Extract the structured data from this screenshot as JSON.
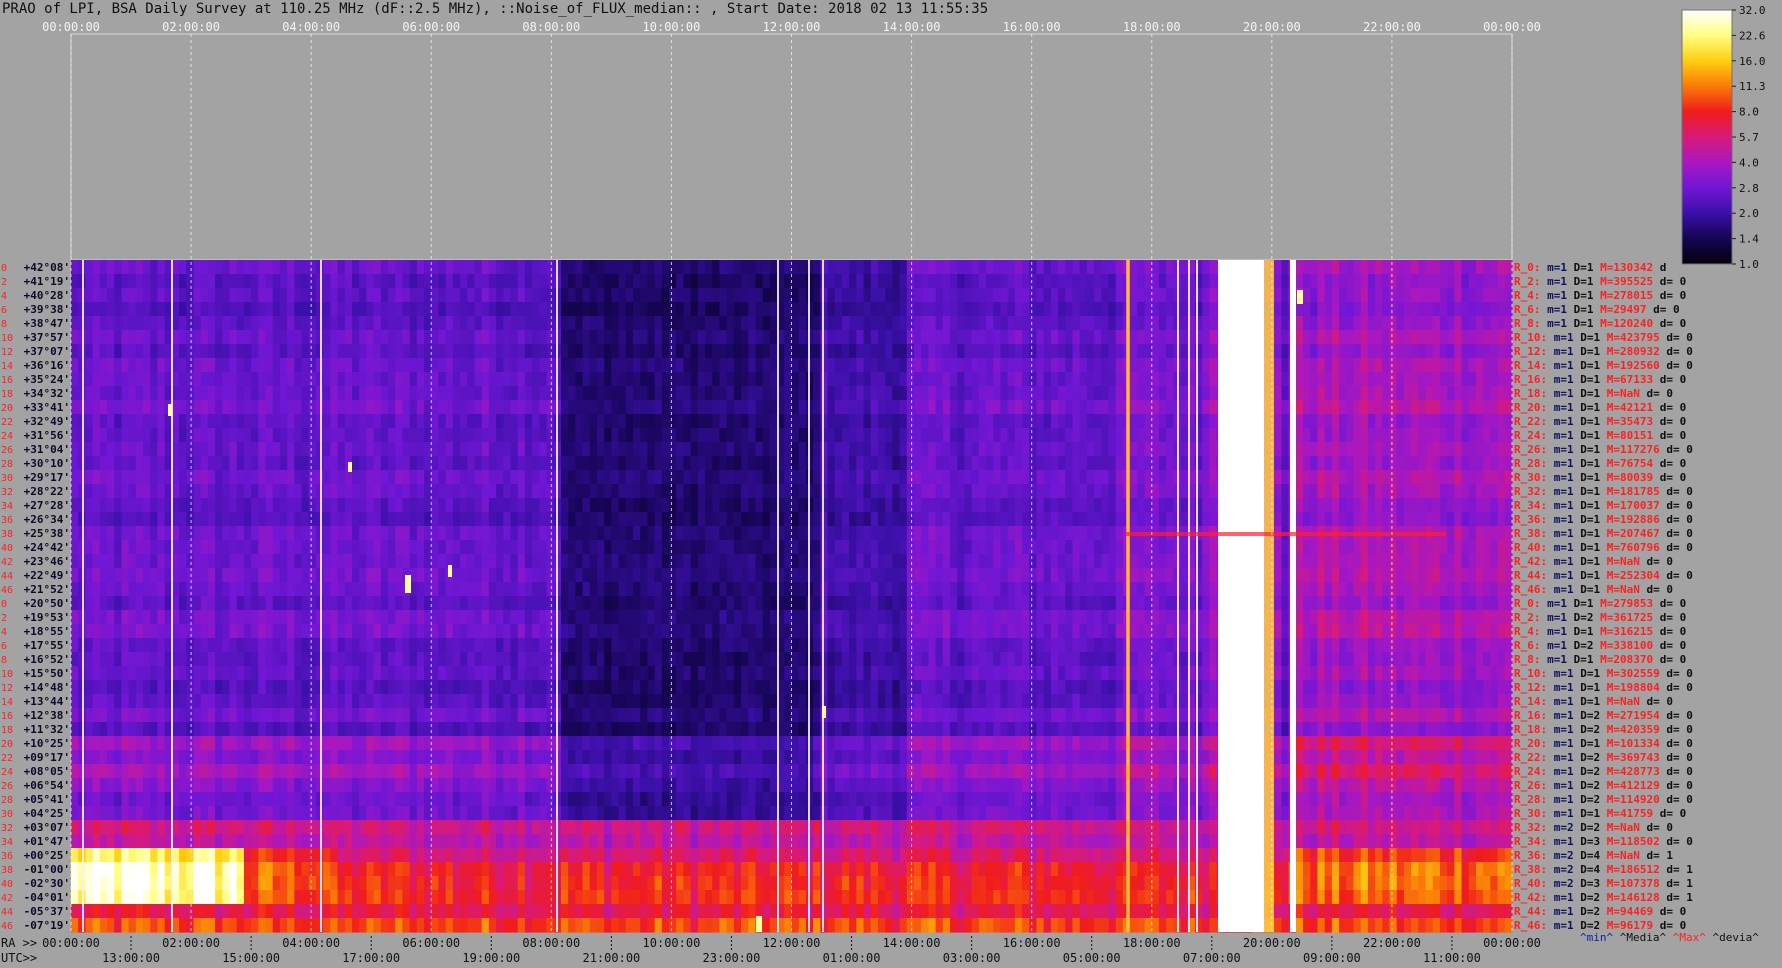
{
  "title": "PRAO of LPI, BSA Daily Survey at 110.25 MHz (dF::2.5 MHz), ::Noise_of_FLUX_median:: , Start Date: 2018 02 13 11:55:35",
  "chart_data": {
    "type": "heatmap",
    "top_axis_ticks": [
      "00:00:00",
      "02:00:00",
      "04:00:00",
      "06:00:00",
      "08:00:00",
      "10:00:00",
      "12:00:00",
      "14:00:00",
      "16:00:00",
      "18:00:00",
      "20:00:00",
      "22:00:00",
      "00:00:00"
    ],
    "bottom_ra_prefix": "RA >>",
    "bottom_ra_ticks": [
      "00:00:00",
      "02:00:00",
      "04:00:00",
      "06:00:00",
      "08:00:00",
      "10:00:00",
      "12:00:00",
      "14:00:00",
      "16:00:00",
      "18:00:00",
      "20:00:00",
      "22:00:00",
      "00:00:00"
    ],
    "bottom_utc_prefix": "UTC>>",
    "bottom_utc_ticks": [
      "13:00:00",
      "15:00:00",
      "17:00:00",
      "19:00:00",
      "21:00:00",
      "23:00:00",
      "01:00:00",
      "03:00:00",
      "05:00:00",
      "07:00:00",
      "09:00:00",
      "11:00:00"
    ],
    "declinations": [
      "+42°08'",
      "+41°19'",
      "+40°28'",
      "+39°38'",
      "+38°47'",
      "+37°57'",
      "+37°07'",
      "+36°16'",
      "+35°24'",
      "+34°32'",
      "+33°41'",
      "+32°49'",
      "+31°56'",
      "+31°04'",
      "+30°10'",
      "+29°17'",
      "+28°22'",
      "+27°28'",
      "+26°34'",
      "+25°38'",
      "+24°42'",
      "+23°46'",
      "+22°49'",
      "+21°52'",
      "+20°50'",
      "+19°53'",
      "+18°55'",
      "+17°55'",
      "+16°52'",
      "+15°50'",
      "+14°48'",
      "+13°44'",
      "+12°38'",
      "+11°32'",
      "+10°25'",
      "+09°17'",
      "+08°05'",
      "+06°54'",
      "+05°41'",
      "+04°25'",
      "+03°07'",
      "+01°47'",
      "+00°25'",
      "-01°00'",
      "-02°30'",
      "-04°01'",
      "-05°37'",
      "-07°19'"
    ],
    "row_numbers": [
      "0",
      "2",
      "4",
      "6",
      "8",
      "10",
      "12",
      "14",
      "16",
      "18",
      "20",
      "22",
      "24",
      "26",
      "28",
      "30",
      "32",
      "34",
      "36",
      "38",
      "40",
      "42",
      "44",
      "46",
      "0",
      "2",
      "4",
      "6",
      "8",
      "10",
      "12",
      "14",
      "16",
      "18",
      "20",
      "22",
      "24",
      "26",
      "28",
      "30",
      "32",
      "34",
      "36",
      "38",
      "40",
      "42",
      "44",
      "46"
    ],
    "stats_rows": [
      {
        "r": "R_0:",
        "m": "m=1",
        "D": "D=1",
        "M": "M=130342",
        "d": "d"
      },
      {
        "r": "R_2:",
        "m": "m=1",
        "D": "D=1",
        "M": "M=395525",
        "d": "d= 0"
      },
      {
        "r": "R_4:",
        "m": "m=1",
        "D": "D=1",
        "M": "M=278015",
        "d": "d= 0"
      },
      {
        "r": "R_6:",
        "m": "m=1",
        "D": "D=1",
        "M": "M=29497",
        "d": "d= 0"
      },
      {
        "r": "R_8:",
        "m": "m=1",
        "D": "D=1",
        "M": "M=120240",
        "d": "d= 0"
      },
      {
        "r": "R_10:",
        "m": "m=1",
        "D": "D=1",
        "M": "M=423795",
        "d": "d= 0"
      },
      {
        "r": "R_12:",
        "m": "m=1",
        "D": "D=1",
        "M": "M=280932",
        "d": "d= 0"
      },
      {
        "r": "R_14:",
        "m": "m=1",
        "D": "D=1",
        "M": "M=192560",
        "d": "d= 0"
      },
      {
        "r": "R_16:",
        "m": "m=1",
        "D": "D=1",
        "M": "M=67133",
        "d": "d= 0"
      },
      {
        "r": "R_18:",
        "m": "m=1",
        "D": "D=1",
        "M": "M=NaN",
        "d": "d= 0"
      },
      {
        "r": "R_20:",
        "m": "m=1",
        "D": "D=1",
        "M": "M=42121",
        "d": "d= 0"
      },
      {
        "r": "R_22:",
        "m": "m=1",
        "D": "D=1",
        "M": "M=35473",
        "d": "d= 0"
      },
      {
        "r": "R_24:",
        "m": "m=1",
        "D": "D=1",
        "M": "M=80151",
        "d": "d= 0"
      },
      {
        "r": "R_26:",
        "m": "m=1",
        "D": "D=1",
        "M": "M=117276",
        "d": "d= 0"
      },
      {
        "r": "R_28:",
        "m": "m=1",
        "D": "D=1",
        "M": "M=76754",
        "d": "d= 0"
      },
      {
        "r": "R_30:",
        "m": "m=1",
        "D": "D=1",
        "M": "M=80039",
        "d": "d= 0"
      },
      {
        "r": "R_32:",
        "m": "m=1",
        "D": "D=1",
        "M": "M=181785",
        "d": "d= 0"
      },
      {
        "r": "R_34:",
        "m": "m=1",
        "D": "D=1",
        "M": "M=170037",
        "d": "d= 0"
      },
      {
        "r": "R_36:",
        "m": "m=1",
        "D": "D=1",
        "M": "M=192886",
        "d": "d= 0"
      },
      {
        "r": "R_38:",
        "m": "m=1",
        "D": "D=1",
        "M": "M=207467",
        "d": "d= 0"
      },
      {
        "r": "R_40:",
        "m": "m=1",
        "D": "D=1",
        "M": "M=760796",
        "d": "d= 0"
      },
      {
        "r": "R_42:",
        "m": "m=1",
        "D": "D=1",
        "M": "M=NaN",
        "d": "d= 0"
      },
      {
        "r": "R_44:",
        "m": "m=1",
        "D": "D=1",
        "M": "M=252304",
        "d": "d= 0"
      },
      {
        "r": "R_46:",
        "m": "m=1",
        "D": "D=1",
        "M": "M=NaN",
        "d": "d= 0"
      },
      {
        "r": "R_0:",
        "m": "m=1",
        "D": "D=1",
        "M": "M=279853",
        "d": "d= 0"
      },
      {
        "r": "R_2:",
        "m": "m=1",
        "D": "D=2",
        "M": "M=361725",
        "d": "d= 0"
      },
      {
        "r": "R_4:",
        "m": "m=1",
        "D": "D=1",
        "M": "M=316215",
        "d": "d= 0"
      },
      {
        "r": "R_6:",
        "m": "m=1",
        "D": "D=2",
        "M": "M=338100",
        "d": "d= 0"
      },
      {
        "r": "R_8:",
        "m": "m=1",
        "D": "D=1",
        "M": "M=208370",
        "d": "d= 0"
      },
      {
        "r": "R_10:",
        "m": "m=1",
        "D": "D=1",
        "M": "M=302559",
        "d": "d= 0"
      },
      {
        "r": "R_12:",
        "m": "m=1",
        "D": "D=1",
        "M": "M=198804",
        "d": "d= 0"
      },
      {
        "r": "R_14:",
        "m": "m=1",
        "D": "D=1",
        "M": "M=NaN",
        "d": "d= 0"
      },
      {
        "r": "R_16:",
        "m": "m=1",
        "D": "D=2",
        "M": "M=271954",
        "d": "d= 0"
      },
      {
        "r": "R_18:",
        "m": "m=1",
        "D": "D=2",
        "M": "M=420359",
        "d": "d= 0"
      },
      {
        "r": "R_20:",
        "m": "m=1",
        "D": "D=1",
        "M": "M=101334",
        "d": "d= 0"
      },
      {
        "r": "R_22:",
        "m": "m=1",
        "D": "D=2",
        "M": "M=369743",
        "d": "d= 0"
      },
      {
        "r": "R_24:",
        "m": "m=1",
        "D": "D=2",
        "M": "M=428773",
        "d": "d= 0"
      },
      {
        "r": "R_26:",
        "m": "m=1",
        "D": "D=2",
        "M": "M=412129",
        "d": "d= 0"
      },
      {
        "r": "R_28:",
        "m": "m=1",
        "D": "D=2",
        "M": "M=114920",
        "d": "d= 0"
      },
      {
        "r": "R_30:",
        "m": "m=1",
        "D": "D=1",
        "M": "M=41759",
        "d": "d= 0"
      },
      {
        "r": "R_32:",
        "m": "m=2",
        "D": "D=2",
        "M": "M=NaN",
        "d": "d= 0"
      },
      {
        "r": "R_34:",
        "m": "m=1",
        "D": "D=3",
        "M": "M=118502",
        "d": "d= 0"
      },
      {
        "r": "R_36:",
        "m": "m=2",
        "D": "D=4",
        "M": "M=NaN",
        "d": "d= 1"
      },
      {
        "r": "R_38:",
        "m": "m=2",
        "D": "D=4",
        "M": "M=186512",
        "d": "d= 1"
      },
      {
        "r": "R_40:",
        "m": "m=2",
        "D": "D=3",
        "M": "M=107378",
        "d": "d= 1"
      },
      {
        "r": "R_42:",
        "m": "m=1",
        "D": "D=2",
        "M": "M=146128",
        "d": "d= 1"
      },
      {
        "r": "R_44:",
        "m": "m=1",
        "D": "D=2",
        "M": "M=94469",
        "d": "d= 0"
      },
      {
        "r": "R_46:",
        "m": "m=1",
        "D": "D=2",
        "M": "M=96179",
        "d": "d= 0"
      }
    ],
    "stats_footer": {
      "min": "^min^",
      "median": "^Media^",
      "max": "^Max^",
      "dev": "^devia^"
    },
    "colorbar_ticks": [
      "32.0",
      "22.6",
      "16.0",
      "11.3",
      "8.0",
      "5.7",
      "4.0",
      "2.8",
      "2.0",
      "1.4",
      "1.0"
    ],
    "colormap": [
      "#05000a",
      "#150552",
      "#3b10a8",
      "#7017d4",
      "#a818c0",
      "#d81a7a",
      "#f01c1c",
      "#fb7a08",
      "#ffce10",
      "#ffff80",
      "#ffffff"
    ]
  }
}
